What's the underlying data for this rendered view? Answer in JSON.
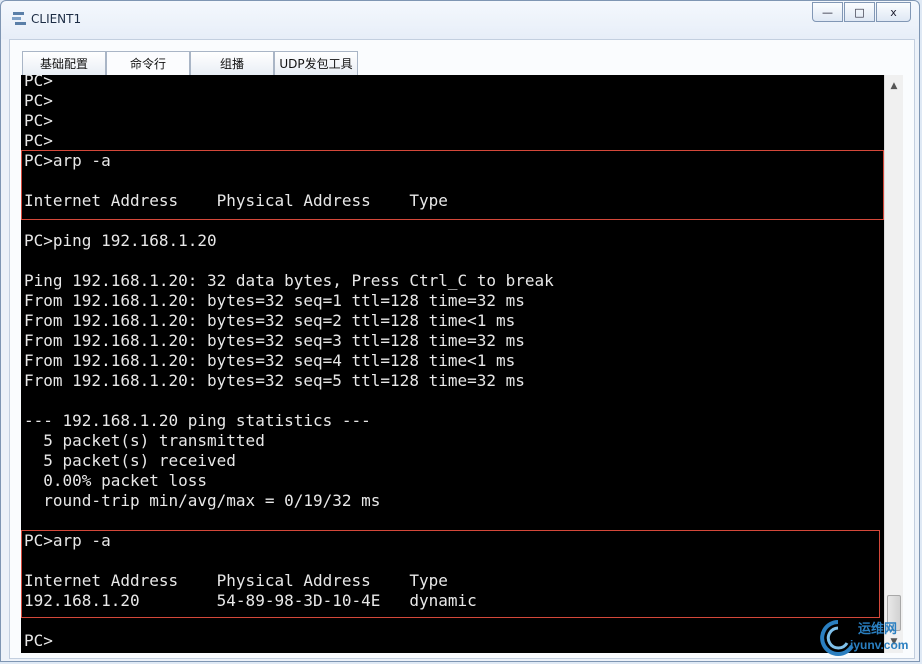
{
  "window": {
    "title": "CLIENT1",
    "icon": "network-client-icon",
    "controls": {
      "minimize": "—",
      "maximize": "□",
      "close": "x"
    }
  },
  "tabs": [
    {
      "label": "基础配置",
      "active": false
    },
    {
      "label": "命令行",
      "active": true
    },
    {
      "label": "组播",
      "active": false
    },
    {
      "label": "UDP发包工具",
      "active": false
    }
  ],
  "terminal": {
    "lines": [
      "PC>",
      "PC>",
      "PC>",
      "PC>",
      "PC>arp -a",
      "",
      "Internet Address    Physical Address    Type",
      "",
      "PC>ping 192.168.1.20",
      "",
      "Ping 192.168.1.20: 32 data bytes, Press Ctrl_C to break",
      "From 192.168.1.20: bytes=32 seq=1 ttl=128 time=32 ms",
      "From 192.168.1.20: bytes=32 seq=2 ttl=128 time<1 ms",
      "From 192.168.1.20: bytes=32 seq=3 ttl=128 time=32 ms",
      "From 192.168.1.20: bytes=32 seq=4 ttl=128 time<1 ms",
      "From 192.168.1.20: bytes=32 seq=5 ttl=128 time=32 ms",
      "",
      "--- 192.168.1.20 ping statistics ---",
      "  5 packet(s) transmitted",
      "  5 packet(s) received",
      "  0.00% packet loss",
      "  round-trip min/avg/max = 0/19/32 ms",
      "",
      "PC>arp -a",
      "",
      "Internet Address    Physical Address    Type",
      "192.168.1.20        54-89-98-3D-10-4E   dynamic",
      "",
      "PC>"
    ],
    "highlight_color": "#d4483a"
  },
  "scrollbar": {
    "up_icon": "▲",
    "down_icon": "▼"
  },
  "watermark": {
    "cn": "运维网",
    "en": "iyunv.com"
  }
}
